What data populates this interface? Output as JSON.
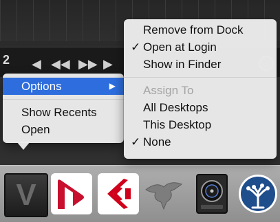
{
  "transport": {
    "counter": "2",
    "buttons": [
      "◀",
      "◀◀",
      "▶▶",
      "▶"
    ]
  },
  "dock_menu": {
    "items": [
      {
        "label": "Options",
        "submenu_arrow": "▶",
        "highlighted": true
      },
      {
        "label": "Show Recents"
      },
      {
        "label": "Open"
      }
    ]
  },
  "options_submenu": {
    "remove_from_dock": "Remove from Dock",
    "open_at_login": "Open at Login",
    "open_at_login_checked": true,
    "show_in_finder": "Show in Finder",
    "assign_to_header": "Assign To",
    "all_desktops": "All Desktops",
    "this_desktop": "This Desktop",
    "none": "None",
    "none_checked": true,
    "check_glyph": "✓"
  },
  "dock": {
    "icons": [
      {
        "name": "v-app-icon",
        "letter": "V"
      },
      {
        "name": "nuendo-icon"
      },
      {
        "name": "cubase-icon"
      },
      {
        "name": "bird-app-icon"
      },
      {
        "name": "logic-pro-icon"
      },
      {
        "name": "sourcetree-icon"
      }
    ]
  },
  "colors": {
    "highlight": "#2d6ddd",
    "menu_bg": "#ececec",
    "nuendo_red": "#c8102e",
    "cubase_red": "#d0021b",
    "sourcetree_blue": "#1f4e8c"
  }
}
